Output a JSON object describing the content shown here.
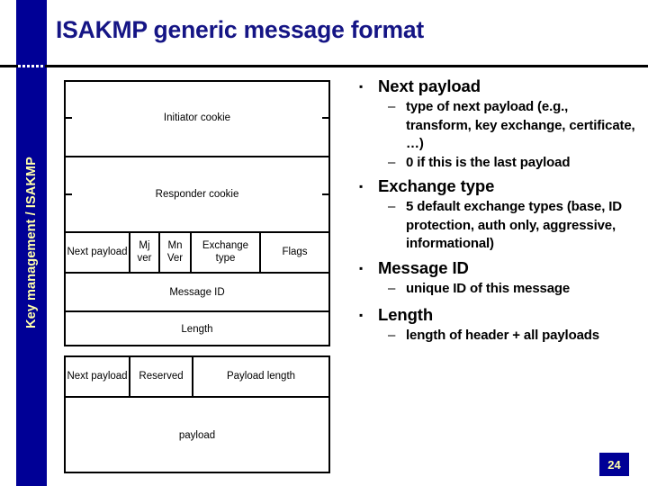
{
  "slide": {
    "title": "ISAKMP generic message format",
    "sidebar_label": "Key management / ISAKMP",
    "page_number": "24",
    "colors": {
      "brand_blue": "#000096",
      "title_navy": "#151585",
      "sidebar_text": "#ffffaa"
    }
  },
  "diagram": {
    "name": "isakmp-generic-message-format",
    "header_rows": [
      {
        "label": "Initiator cookie",
        "has_side_ticks": true
      },
      {
        "label": "Responder cookie",
        "has_side_ticks": true
      }
    ],
    "field_row": [
      {
        "label": "Next payload"
      },
      {
        "label": "Mj ver"
      },
      {
        "label": "Mn Ver"
      },
      {
        "label": "Exchange type"
      },
      {
        "label": "Flags"
      }
    ],
    "message_id": "Message ID",
    "length": "Length",
    "payload_header_row": [
      {
        "label": "Next payload"
      },
      {
        "label": "Reserved"
      },
      {
        "label": "Payload length"
      }
    ],
    "payload_body": "payload"
  },
  "bullets": [
    {
      "text": "Next payload",
      "marker": "▪",
      "children": [
        {
          "text": "type of next payload (e.g., transform, key exchange, certificate, …)",
          "marker": "–"
        },
        {
          "text": "0 if this is the last payload",
          "marker": "–"
        }
      ]
    },
    {
      "text": "Exchange type",
      "marker": "▪",
      "children": [
        {
          "text": "5 default exchange types (base, ID protection, auth only, aggressive, informational)",
          "marker": "–"
        }
      ]
    },
    {
      "text": "Message ID",
      "marker": "▪",
      "children": [
        {
          "text": "unique ID of this message",
          "marker": "–"
        }
      ]
    },
    {
      "text": "Length",
      "marker": "▪",
      "children": [
        {
          "text": "length of header + all payloads",
          "marker": "–"
        }
      ]
    }
  ]
}
